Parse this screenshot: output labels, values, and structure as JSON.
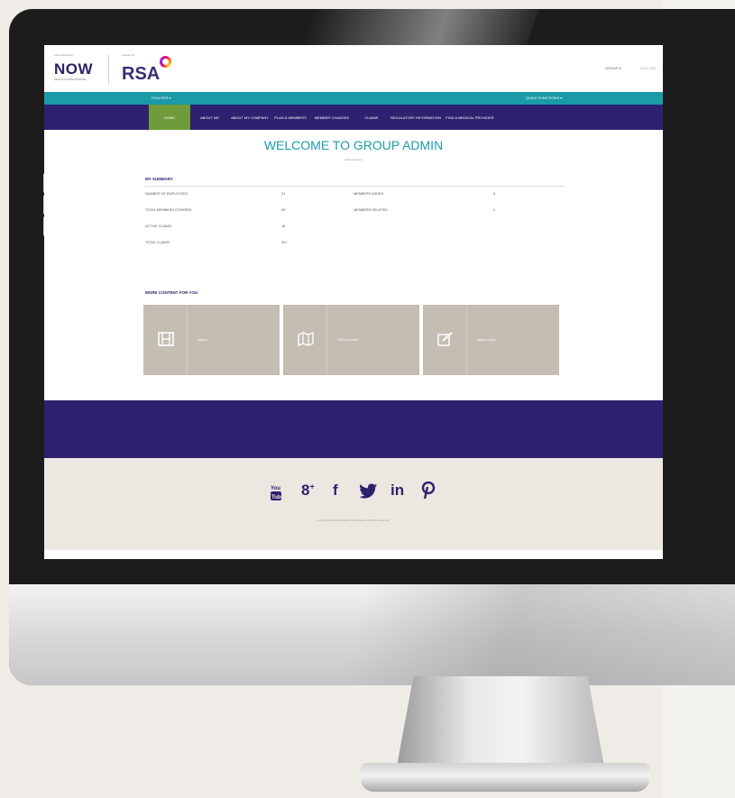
{
  "header": {
    "now_small": "Administered by",
    "now_logo": "NOW",
    "now_sub": "HEALTH INTERNATIONAL",
    "rsa_small": "Insured by",
    "rsa_logo": "RSA",
    "user_menu": "GROUP ▾",
    "logout": "LOG OUT"
  },
  "teal_bar": {
    "left": "POLICIES ▾",
    "right": "QUICK FUNCTIONS ▾"
  },
  "nav": {
    "items": [
      {
        "label": "HOME",
        "active": true
      },
      {
        "label": "ABOUT ME"
      },
      {
        "label": "ABOUT MY COMPANY"
      },
      {
        "label": "PLAN & MEMBERS"
      },
      {
        "label": "MEMBER CHANGES"
      },
      {
        "label": "CLAIMS"
      },
      {
        "label": "REGULATORY INFORMATION"
      },
      {
        "label": "FIND A MEDICAL PROVIDER"
      }
    ]
  },
  "main": {
    "title": "WELCOME TO GROUP ADMIN",
    "subtitle": "Hello Company"
  },
  "summary": {
    "title": "MY SUMMARY",
    "rows": [
      {
        "label": "NUMBER OF EMPLOYEES",
        "value": "21"
      },
      {
        "label": "TOTAL MEMBERS COVERED",
        "value": "45"
      },
      {
        "label": "ACTIVE CLAIMS",
        "value": "16"
      },
      {
        "label": "TOTAL CLAIMS",
        "value": "321"
      }
    ],
    "rows_right": [
      {
        "label": "MEMBERS ADDED",
        "value": "5"
      },
      {
        "label": "MEMBERS DELETED",
        "value": "2"
      }
    ]
  },
  "more": {
    "title": "MORE CONTENT FOR YOU",
    "tiles": [
      {
        "icon": "film-icon",
        "label": "Videos"
      },
      {
        "icon": "map-icon",
        "label": "Find a provider"
      },
      {
        "icon": "edit-icon",
        "label": "Make a claim"
      }
    ]
  },
  "footer": {
    "social": [
      {
        "name": "youtube-icon",
        "glyph": "▣"
      },
      {
        "name": "google-plus-icon",
        "glyph": "8⁺"
      },
      {
        "name": "facebook-icon",
        "glyph": "f"
      },
      {
        "name": "twitter-icon",
        "glyph": "🐦"
      },
      {
        "name": "linkedin-icon",
        "glyph": "in"
      },
      {
        "name": "pinterest-icon",
        "glyph": "P"
      }
    ],
    "copyright": "Copyright 2016 Now Health International. All rights reserved."
  },
  "colors": {
    "purple": "#2d2170",
    "teal": "#1a9ba7",
    "green": "#6f9b3a",
    "tile": "#c3bdb2"
  }
}
